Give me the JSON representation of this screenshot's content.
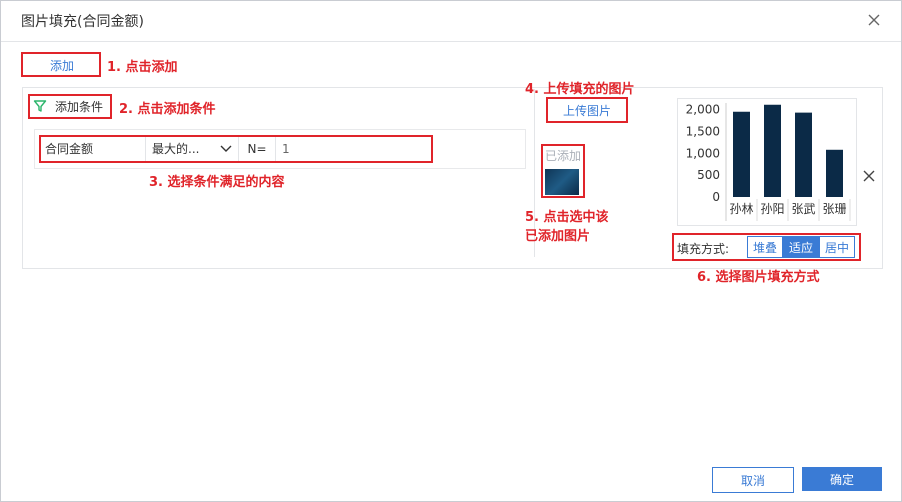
{
  "dialog": {
    "title": "图片填充(合同金额)",
    "add_label": "添加",
    "add_condition_label": "添加条件",
    "condition": {
      "field": "合同金额",
      "operator": "最大的...",
      "n_label": "N=",
      "n_value": "1"
    },
    "upload_label": "上传图片",
    "added_label": "已添加",
    "fill_mode_label": "填充方式:",
    "fill_modes": [
      "堆叠",
      "适应",
      "居中"
    ],
    "fill_mode_selected": "适应",
    "cancel_label": "取消",
    "ok_label": "确定"
  },
  "annotations": {
    "a1": "1. 点击添加",
    "a2": "2. 点击添加条件",
    "a3": "3. 选择条件满足的内容",
    "a4": "4. 上传填充的图片",
    "a5_line1": "5. 点击选中该",
    "a5_line2": "已添加图片",
    "a6": "6. 选择图片填充方式"
  },
  "colors": {
    "accent": "#3a7bd5",
    "annotation": "#e0242a",
    "bar": "#0b2a47"
  },
  "chart_data": {
    "type": "bar",
    "categories": [
      "孙林",
      "孙阳",
      "张武",
      "张珊"
    ],
    "values": [
      1950,
      2110,
      1930,
      1080
    ],
    "yticks": [
      "2,000",
      "1,500",
      "1,000",
      "500",
      "0"
    ],
    "ylim": [
      0,
      2150
    ]
  }
}
